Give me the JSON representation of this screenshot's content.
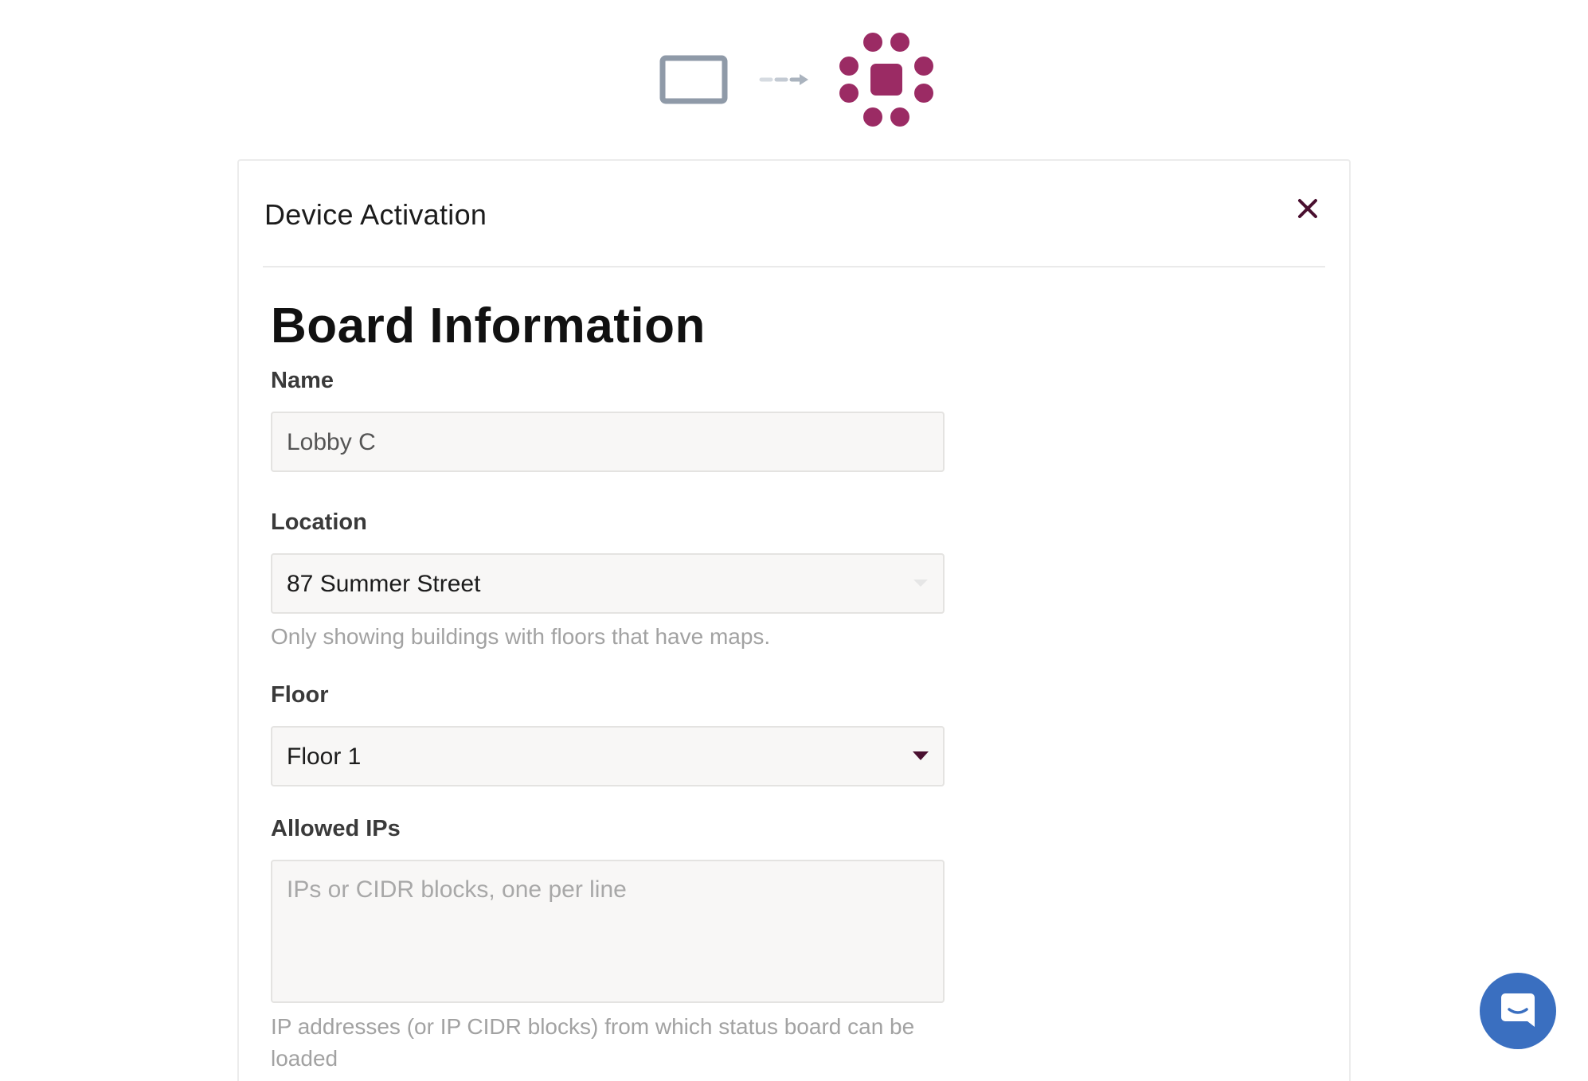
{
  "colors": {
    "accent": "#9b2b64",
    "device_gray": "#8f9aa8",
    "arrow_gray": "#b7c0cb",
    "close_icon": "#4a1030",
    "chat_launcher": "#3a6fc0"
  },
  "illustration": {
    "icons": [
      "tablet-icon",
      "dashed-arrow-icon",
      "conference-table-icon"
    ]
  },
  "modal": {
    "title": "Device Activation",
    "close_icon": "close-icon"
  },
  "form": {
    "section_title": "Board Information",
    "name": {
      "label": "Name",
      "value": "Lobby C"
    },
    "location": {
      "label": "Location",
      "value": "87 Summer Street",
      "help": "Only showing buildings with floors that have maps."
    },
    "floor": {
      "label": "Floor",
      "value": "Floor 1"
    },
    "allowed_ips": {
      "label": "Allowed IPs",
      "placeholder": "IPs or CIDR blocks, one per line",
      "help": "IP addresses (or IP CIDR blocks) from which status board can be loaded"
    }
  },
  "chat": {
    "icon": "chat-icon"
  }
}
